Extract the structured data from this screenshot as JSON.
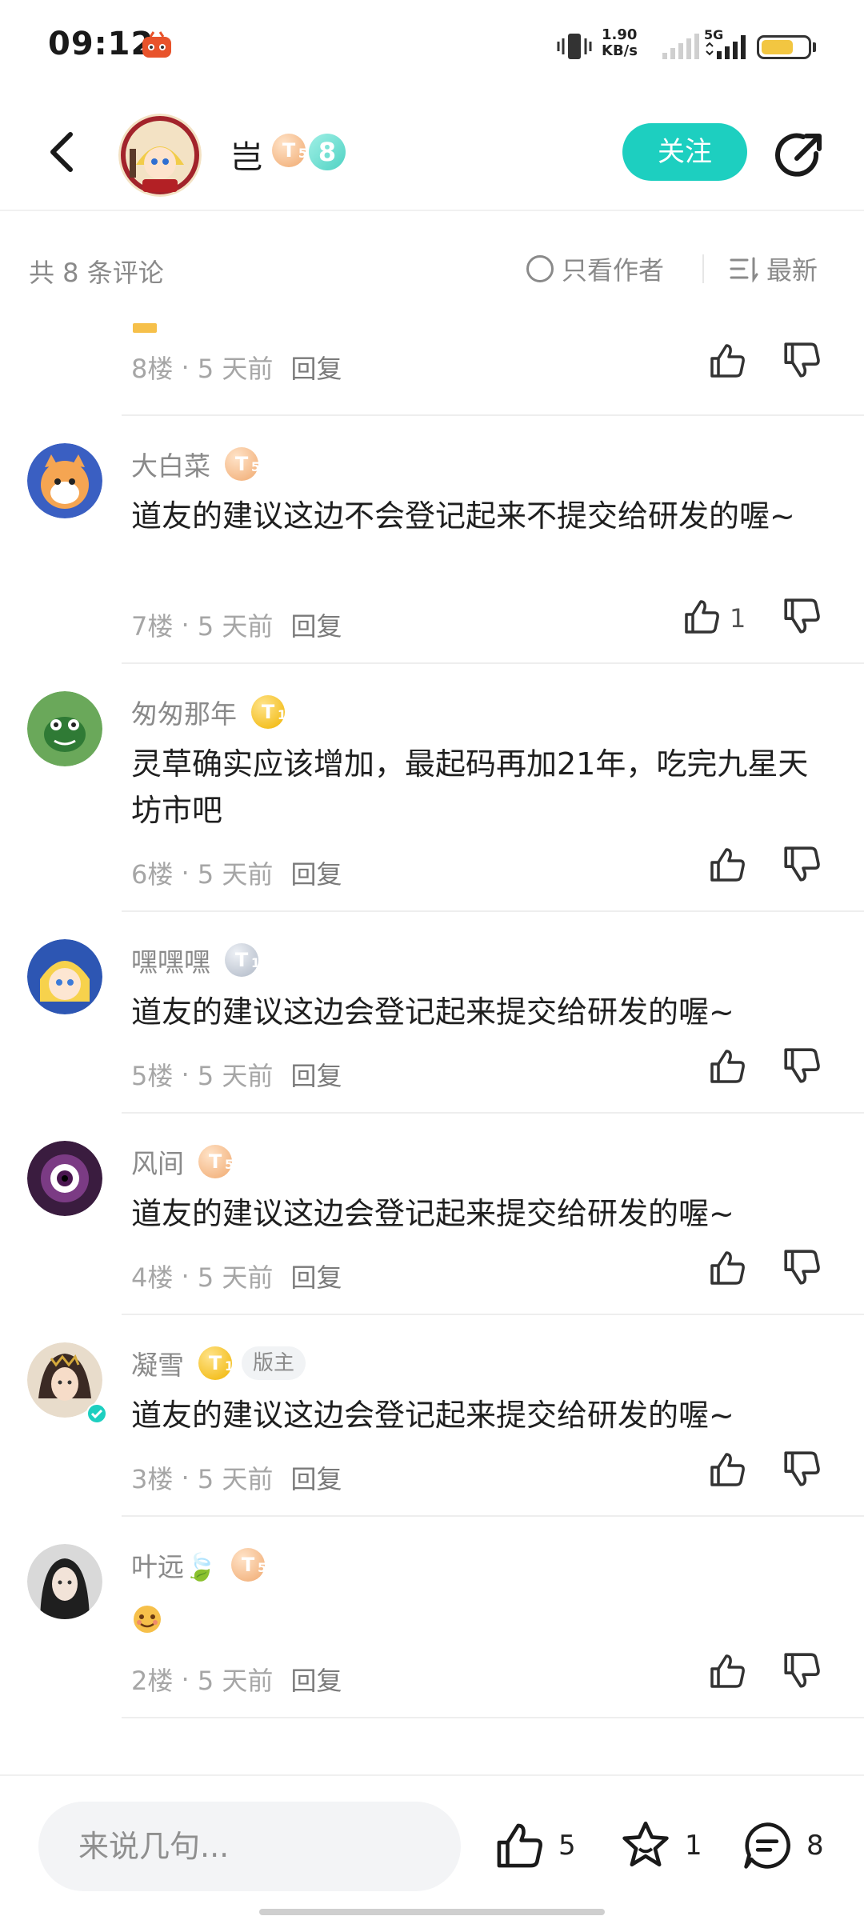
{
  "status_bar": {
    "time": "09:12",
    "net_speed_value": "1.90",
    "net_speed_unit": "KB/s",
    "network_type": "5G",
    "battery_level": 0.7,
    "icons": [
      "notification-app-icon",
      "vibrate-icon",
      "signal-icon",
      "signal-5g-icon",
      "battery-icon"
    ]
  },
  "header": {
    "author_name": "岂",
    "author_level_badge": "T",
    "author_level_sub": "5",
    "author_rank_badge": "8",
    "follow_label": "关注",
    "icons": [
      "back-icon",
      "share-icon"
    ]
  },
  "filter_bar": {
    "comment_count": "共 8 条评论",
    "only_author_label": "只看作者",
    "sort_label": "最新"
  },
  "comments": [
    {
      "floor": "8楼",
      "time": "5 天前",
      "reply_label": "回复",
      "like_count": ""
    },
    {
      "name": "大白菜",
      "badge": "T",
      "badge_sub": "5",
      "text": "道友的建议这边不会登记起来不提交给研发的喔~",
      "floor": "7楼",
      "time": "5 天前",
      "reply_label": "回复",
      "like_count": "1"
    },
    {
      "name": "匆匆那年",
      "badge": "T",
      "badge_sub": "1",
      "text": "灵草确实应该增加，最起码再加21年，吃完九星天坊市吧",
      "floor": "6楼",
      "time": "5 天前",
      "reply_label": "回复",
      "like_count": ""
    },
    {
      "name": "嘿嘿嘿",
      "badge": "T",
      "badge_sub": "1",
      "text": "道友的建议这边会登记起来提交给研发的喔~",
      "floor": "5楼",
      "time": "5 天前",
      "reply_label": "回复",
      "like_count": ""
    },
    {
      "name": "风间",
      "badge": "T",
      "badge_sub": "5",
      "text": "道友的建议这边会登记起来提交给研发的喔~",
      "floor": "4楼",
      "time": "5 天前",
      "reply_label": "回复",
      "like_count": ""
    },
    {
      "name": "凝雪",
      "badge": "T",
      "badge_sub": "1",
      "tag": "版主",
      "text": "道友的建议这边会登记起来提交给研发的喔~",
      "floor": "3楼",
      "time": "5 天前",
      "reply_label": "回复",
      "like_count": ""
    },
    {
      "name": "叶远🍃",
      "badge": "T",
      "badge_sub": "5",
      "text": "",
      "floor": "2楼",
      "time": "5 天前",
      "reply_label": "回复",
      "like_count": ""
    }
  ],
  "bottom_bar": {
    "input_placeholder": "来说几句...",
    "like_count": "5",
    "favorite_count": "1",
    "comment_count": "8"
  },
  "colors": {
    "accent": "#1dcfc0",
    "muted_text": "#8a8a8a",
    "badge_bronze": "#f0a96f",
    "badge_gold": "#f0b400",
    "badge_silver": "#aeb7c5"
  }
}
